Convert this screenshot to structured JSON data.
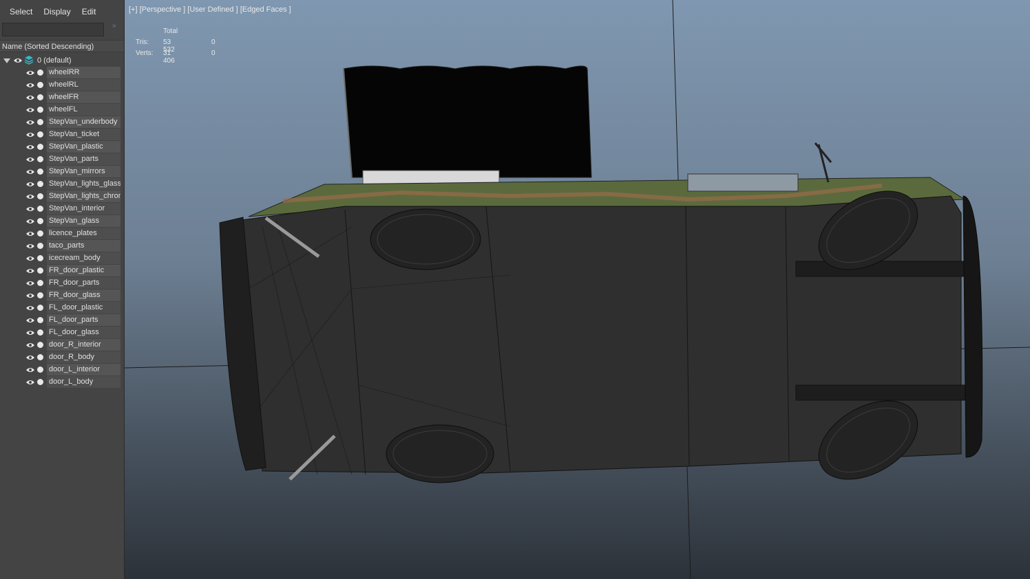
{
  "menu": [
    "Select",
    "Display",
    "Edit"
  ],
  "filter_arrow": "»",
  "sort_header": "Name (Sorted Descending)",
  "layer": {
    "name": "0 (default)"
  },
  "items": [
    "wheelRR",
    "wheelRL",
    "wheelFR",
    "wheelFL",
    "StepVan_underbody",
    "StepVan_ticket",
    "StepVan_plastic",
    "StepVan_parts",
    "StepVan_mirrors",
    "StepVan_lights_glass",
    "StepVan_lights_chrom",
    "StepVan_interior",
    "StepVan_glass",
    "licence_plates",
    "taco_parts",
    "icecream_body",
    "FR_door_plastic",
    "FR_door_parts",
    "FR_door_glass",
    "FL_door_plastic",
    "FL_door_parts",
    "FL_door_glass",
    "door_R_interior",
    "door_R_body",
    "door_L_interior",
    "door_L_body"
  ],
  "viewport": {
    "header": "[+] [Perspective ] [User Defined ] [Edged Faces ]",
    "stats": {
      "total_label": "Total",
      "tris_label": "Tris:",
      "tris_total": "53 532",
      "tris_sel": "0",
      "verts_label": "Verts:",
      "verts_total": "31 406",
      "verts_sel": "0"
    }
  },
  "colors": {
    "panel_bg": "#444444",
    "viewport_top": "#7f97b0",
    "viewport_bottom": "#2c3239",
    "accent": "#5a82a8"
  }
}
